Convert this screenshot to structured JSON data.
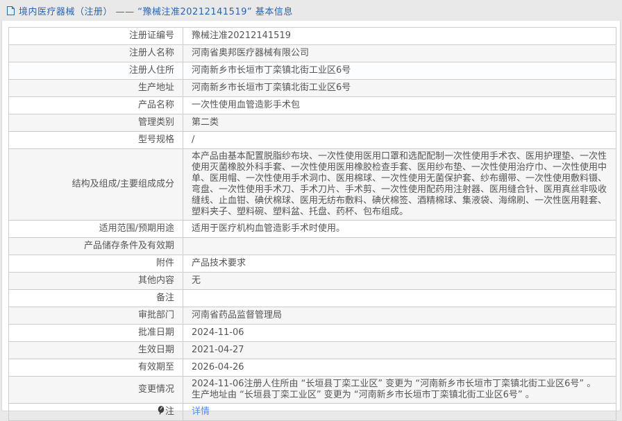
{
  "colors": {
    "page_background": "#e9e9e9",
    "title_blue": "#2a64ae",
    "link_blue": "#4b8df8",
    "table_border": "#cccccc",
    "row_alt_background": "#f6f6f6",
    "text_gray": "#555555"
  },
  "header": {
    "icon": "document-icon",
    "title": "境内医疗器械（注册） —— “豫械注准20212141519” 基本信息"
  },
  "table": {
    "rows": [
      {
        "label": "注册证编号",
        "value": "豫械注准20212141519"
      },
      {
        "label": "注册人名称",
        "value": "河南省奥邦医疗器械有限公司"
      },
      {
        "label": "注册人住所",
        "value": "河南新乡市长垣市丁栾镇北街工业区6号"
      },
      {
        "label": "生产地址",
        "value": "河南新乡市长垣市丁栾镇北街工业区6号"
      },
      {
        "label": "产品名称",
        "value": "一次性使用血管造影手术包"
      },
      {
        "label": "管理类别",
        "value": "第二类"
      },
      {
        "label": "型号规格",
        "value": "/"
      },
      {
        "label": "结构及组成/主要组成成分",
        "value": "本产品由基本配置脱脂纱布块、一次性使用医用口罩和选配配制一次性使用手术衣、医用护理垫、一次性使用灭菌橡胶外科手套、一次性使用医用橡胶检查手套、医用纱布垫、一次性使用治疗巾、一次性使用中单、医用帽、一次性使用手术洞巾、医用棉球、一次性使用无菌保护套、纱布绷带、一次性使用敷料镊、弯盘、一次性使用手术刀、手术刀片、手术剪、一次性使用配药用注射器、医用缝合针、医用真丝非吸收缝线、止血钳、碘伏棉球、医用无纺布敷料、碘伏棉签、酒精棉球、集液袋、海绵刷、一次性医用鞋套、塑料夹子、塑料碗、塑料盆、托盘、药杯、包布组成。"
      },
      {
        "label": "适用范围/预期用途",
        "value": "适用于医疗机构血管造影手术时使用。"
      },
      {
        "label": "产品储存条件及有效期",
        "value": ""
      },
      {
        "label": "附件",
        "value": "产品技术要求"
      },
      {
        "label": "其他内容",
        "value": "无"
      },
      {
        "label": "备注",
        "value": ""
      },
      {
        "label": "审批部门",
        "value": "河南省药品监督管理局"
      },
      {
        "label": "批准日期",
        "value": "2024-11-06"
      },
      {
        "label": "生效日期",
        "value": "2021-04-27"
      },
      {
        "label": "有效期至",
        "value": "2026-04-26"
      },
      {
        "label": "变更情况",
        "lines": [
          "2024-11-06注册人住所由 “长垣县丁栾工业区” 变更为 “河南新乡市长垣市丁栾镇北街工业区6号” 。",
          "生产地址由 “长垣县丁栾工业区” 变更为 “河南新乡市长垣市丁栾镇北街工业区6号” 。"
        ]
      },
      {
        "label": "注",
        "label_icon": "note-icon",
        "link": "详情"
      }
    ]
  }
}
